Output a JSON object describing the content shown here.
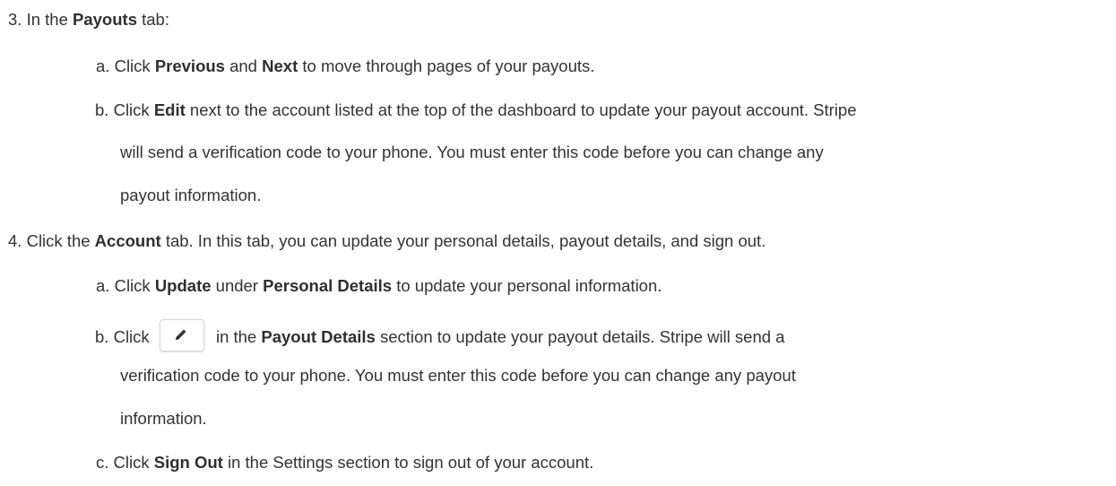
{
  "steps": {
    "s3": {
      "num": "3.",
      "pre": "In the",
      "bold": "Payouts",
      "post": "tab:",
      "a": {
        "num": "a.",
        "t1": "Click",
        "b1": "Previous",
        "t2": "and",
        "b2": "Next",
        "t3": "to move through pages of your payouts."
      },
      "b": {
        "num": "b.",
        "t1": "Click",
        "b1": "Edit",
        "line1": "next to the account listed at the top of the dashboard to update your payout account. Stripe",
        "line2": "will send a verification code to your phone. You must enter this code before you can change any",
        "line3": "payout information."
      }
    },
    "s4": {
      "num": "4.",
      "pre": "Click the",
      "bold": "Account",
      "post": "tab. In this tab, you can update your personal details, payout details, and sign out.",
      "a": {
        "num": "a.",
        "t1": "Click",
        "b1": "Update",
        "t2": "under",
        "b2": "Personal Details",
        "t3": "to update your personal information."
      },
      "b": {
        "num": "b.",
        "t1": "Click",
        "icon": "pencil-icon",
        "t2": "in the",
        "b1": "Payout Details",
        "line1": "section to update your payout details. Stripe will send a",
        "line2": "verification code to your phone. You must enter this code before you can change any payout",
        "line3": "information."
      },
      "c": {
        "num": "c.",
        "t1": "Click",
        "b1": "Sign Out",
        "t2": "in the Settings section to sign out of your account."
      }
    }
  }
}
